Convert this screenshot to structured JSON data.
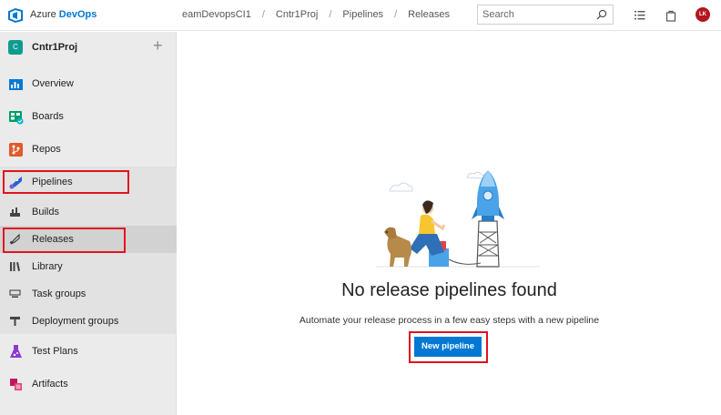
{
  "header": {
    "brand_prefix": "Azure ",
    "brand_name": "DevOps",
    "breadcrumbs": [
      "eamDevopsCI1",
      "Cntr1Proj",
      "Pipelines",
      "Releases"
    ],
    "breadcrumb_separator": "/",
    "search_placeholder": "Search",
    "avatar_initials": "LK"
  },
  "sidebar": {
    "project_initial": "C",
    "project_name": "Cntr1Proj",
    "add_label": "+",
    "items": [
      {
        "label": "Overview",
        "icon": "overview-icon"
      },
      {
        "label": "Boards",
        "icon": "boards-icon"
      },
      {
        "label": "Repos",
        "icon": "repos-icon"
      },
      {
        "label": "Pipelines",
        "icon": "pipelines-icon"
      },
      {
        "label": "Test Plans",
        "icon": "test-plans-icon"
      },
      {
        "label": "Artifacts",
        "icon": "artifacts-icon"
      }
    ],
    "sub_items": [
      {
        "label": "Builds",
        "icon": "builds-icon"
      },
      {
        "label": "Releases",
        "icon": "releases-icon",
        "selected": true
      },
      {
        "label": "Library",
        "icon": "library-icon"
      },
      {
        "label": "Task groups",
        "icon": "task-groups-icon"
      },
      {
        "label": "Deployment groups",
        "icon": "deployment-groups-icon"
      }
    ]
  },
  "main": {
    "empty_title": "No release pipelines found",
    "empty_description": "Automate your release process in a few easy steps with a new pipeline",
    "new_pipeline_label": "New pipeline"
  },
  "colors": {
    "accent": "#0078d4",
    "highlight": "#e0141e",
    "sidebar_bg": "#ebebeb",
    "avatar_bg": "#b3161e"
  }
}
